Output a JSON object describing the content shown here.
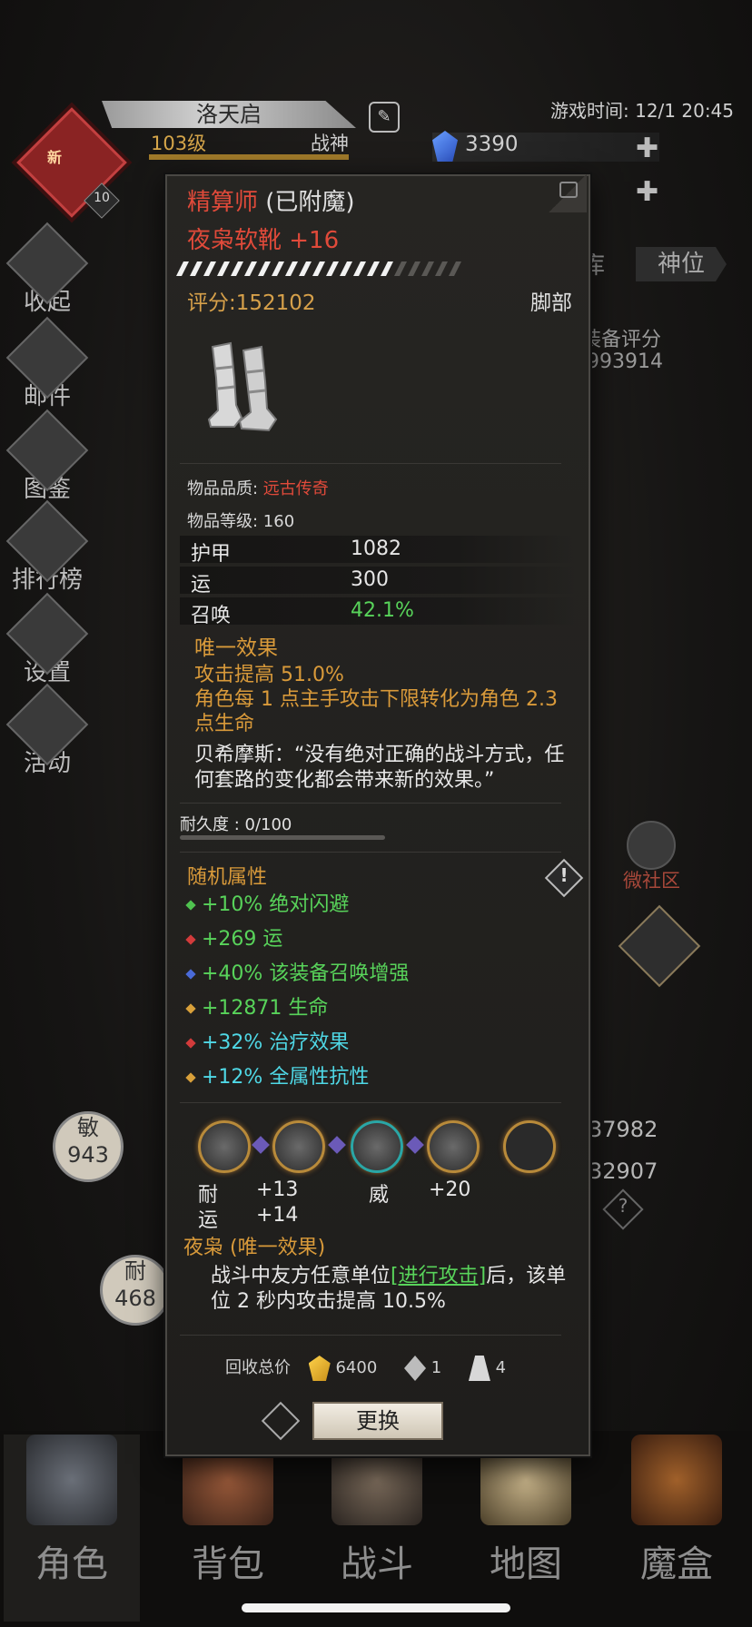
{
  "player": {
    "name": "洛天启",
    "level": "103级",
    "rank": "战神",
    "avatar_badge": "新",
    "avatar_level": "10"
  },
  "header": {
    "game_time": "游戏时间: 12/1 20:45",
    "gems": "3390"
  },
  "sidebar": {
    "items": [
      {
        "label": "收起",
        "icon": "collapse-icon"
      },
      {
        "label": "邮件",
        "icon": "mail-icon"
      },
      {
        "label": "图鉴",
        "icon": "book-icon"
      },
      {
        "label": "排行榜",
        "icon": "leaderboard-icon"
      },
      {
        "label": "设置",
        "icon": "gear-icon"
      },
      {
        "label": "活动",
        "icon": "event-icon"
      }
    ]
  },
  "right_panel": {
    "tab_partial": "库",
    "tab_shenwei": "神位",
    "equip_score_label": "装备评分",
    "equip_score_value": "993914",
    "community": "微社区",
    "stat_right_1": "37982",
    "stat_right_2": "32907"
  },
  "left_stats": {
    "agility_label": "敏",
    "agility_value": "943",
    "endurance_label": "耐",
    "endurance_value": "468"
  },
  "item": {
    "enchant_prefix": "精算师",
    "enchant_suffix": "(已附魔)",
    "name": "夜枭软靴 +16",
    "score": "评分:152102",
    "slot": "脚部",
    "quality_label": "物品品质: ",
    "quality_value": "远古传奇",
    "item_level": "物品等级: 160",
    "stats": [
      {
        "name": "护甲",
        "value": "1082",
        "green": false
      },
      {
        "name": "运",
        "value": "300",
        "green": false
      },
      {
        "name": "召唤",
        "value": "42.1%",
        "green": true
      }
    ],
    "unique_header": "唯一效果",
    "unique_text_1": "攻击提高 51.0%",
    "unique_text_2": "角色每 1 点主手攻击下限转化为角色 2.3 点生命",
    "quote": "贝希摩斯：“没有绝对正确的战斗方式，任何套路的变化都会带来新的效果。”",
    "durability": "耐久度 : 0/100",
    "durability_fraction": 0,
    "random_header": "随机属性",
    "random_attrs": [
      {
        "text": "+10% 绝对闪避",
        "color": "#58d35a",
        "dot": "#4fc24f"
      },
      {
        "text": "+269 运",
        "color": "#58d35a",
        "dot": "#d23b3b"
      },
      {
        "text": "+40% 该装备召唤增强",
        "color": "#58d35a",
        "dot": "#4a6ad8"
      },
      {
        "text": "+12871 生命",
        "color": "#58d35a",
        "dot": "#d9a03a"
      },
      {
        "text": "+32% 治疗效果",
        "color": "#4fd8e6",
        "dot": "#d23b3b"
      },
      {
        "text": "+12% 全属性抗性",
        "color": "#4fd8e6",
        "dot": "#d9a03a"
      }
    ],
    "gem_labels": {
      "a1": "耐",
      "a2": "运",
      "b1": "+13",
      "b2": "+14",
      "c1": "威",
      "d1": "+20"
    },
    "set_header": "夜枭 (唯一效果)",
    "set_text_1": "战斗中友方任意单位",
    "set_link": "[进行攻击]",
    "set_text_2": "后，该单位 2 秒内攻击提高 10.5%",
    "recycle_label": "回收总价",
    "recycle_gold": "6400",
    "recycle_res1": "1",
    "recycle_res2": "4",
    "change_button": "更换"
  },
  "bottom_nav": {
    "items": [
      {
        "label": "角色",
        "icon": "helmet-icon",
        "active": true
      },
      {
        "label": "背包",
        "icon": "backpack-icon",
        "active": false
      },
      {
        "label": "战斗",
        "icon": "sword-shield-icon",
        "active": false
      },
      {
        "label": "地图",
        "icon": "scroll-map-icon",
        "active": false
      },
      {
        "label": "魔盒",
        "icon": "magic-box-icon",
        "active": false
      }
    ]
  },
  "colors": {
    "enchant_red": "#e04a3a",
    "gold": "#d99a3a",
    "green": "#58d35a",
    "cyan": "#4fd8e6"
  }
}
